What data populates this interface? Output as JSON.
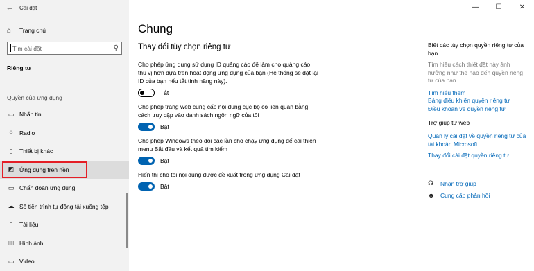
{
  "window": {
    "title": "Cài đặt",
    "minimize_glyph": "—",
    "maximize_glyph": "☐",
    "close_glyph": "✕",
    "back_glyph": "←"
  },
  "sidebar": {
    "home_label": "Trang chủ",
    "search_placeholder": "Tìm cài đặt",
    "section_title": "Riêng tư",
    "group_title": "Quyền của ứng dụng",
    "items": [
      {
        "label": "Nhắn tin",
        "icon": "message-icon",
        "glyph": "▭"
      },
      {
        "label": "Radio",
        "icon": "radio-icon",
        "glyph": "⁘"
      },
      {
        "label": "Thiết bị khác",
        "icon": "device-icon",
        "glyph": "▯"
      },
      {
        "label": "Ứng dụng trên nền",
        "icon": "background-apps-icon",
        "glyph": "◩",
        "selected": true
      },
      {
        "label": "Chẩn đoán ứng dụng",
        "icon": "diagnostics-icon",
        "glyph": "▭"
      },
      {
        "label": "Số tiền trình tự động tải xuống tệp",
        "icon": "cloud-icon",
        "glyph": "☁"
      },
      {
        "label": "Tài liệu",
        "icon": "document-icon",
        "glyph": "▯"
      },
      {
        "label": "Hình ảnh",
        "icon": "image-icon",
        "glyph": "◫"
      },
      {
        "label": "Video",
        "icon": "video-icon",
        "glyph": "▭"
      }
    ]
  },
  "main": {
    "title": "Chung",
    "subtitle": "Thay đổi tùy chọn riêng tư",
    "settings": [
      {
        "desc": "Cho phép ứng dụng sử dụng ID quảng cáo để làm cho quảng cáo thú vị hơn dựa trên hoạt động ứng dụng của bạn (Hệ thống sẽ đặt lại ID của bạn nếu tắt tính năng này).",
        "state": "Tắt",
        "on": false
      },
      {
        "desc": "Cho phép trang web cung cấp nội dung cục bộ có liên quan bằng cách truy cập vào danh sách ngôn ngữ của tôi",
        "state": "Bật",
        "on": true
      },
      {
        "desc": "Cho phép Windows theo dõi các lần cho chạy ứng dụng để cải thiện menu Bắt đầu và kết quả tìm kiếm",
        "state": "Bật",
        "on": true
      },
      {
        "desc": "Hiển thị cho tôi nội dung được đề xuất trong ứng dụng Cài đặt",
        "state": "Bật",
        "on": true
      }
    ]
  },
  "right_panel": {
    "heading": "Biết các tùy chọn quyền riêng tư của bạn",
    "muted": "Tìm hiểu cách thiết đặt này ảnh hưởng như thế nào đến quyền riêng tư của bạn.",
    "links": [
      "Tìm hiểu thêm",
      "Bảng điều khiển quyền riêng tư",
      "Điều khoản về quyền riêng tư"
    ],
    "web_help_heading": "Trợ giúp từ web",
    "web_help_links": [
      "Quản lý cài đặt về quyền riêng tư của tài khoản Microsoft",
      "Thay đổi cài đặt quyền riêng tư"
    ],
    "actions": [
      {
        "label": "Nhận trợ giúp",
        "icon": "help-icon",
        "glyph": "☊"
      },
      {
        "label": "Cung cấp phản hồi",
        "icon": "feedback-icon",
        "glyph": "☻"
      }
    ]
  }
}
